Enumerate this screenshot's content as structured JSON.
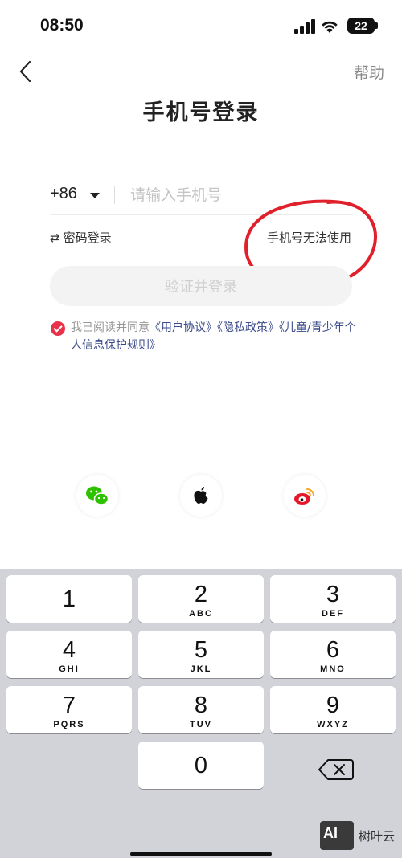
{
  "status_bar": {
    "time": "08:50",
    "battery": "22"
  },
  "nav": {
    "help_label": "帮助"
  },
  "title": "手机号登录",
  "phone": {
    "country_code": "+86",
    "placeholder": "请输入手机号",
    "value": ""
  },
  "links": {
    "password_login": "密码登录",
    "phone_unavailable": "手机号无法使用"
  },
  "verify_button": "验证并登录",
  "agreement": {
    "prefix": "我已阅读并同意",
    "user_agreement": "《用户协议》",
    "privacy_policy": "《隐私政策》",
    "children_rules": "《儿童/青少年个人信息保护规则》",
    "checked": true
  },
  "social": [
    "wechat-icon",
    "apple-icon",
    "weibo-icon"
  ],
  "keyboard": {
    "keys": [
      {
        "digit": "1",
        "letters": ""
      },
      {
        "digit": "2",
        "letters": "ABC"
      },
      {
        "digit": "3",
        "letters": "DEF"
      },
      {
        "digit": "4",
        "letters": "GHI"
      },
      {
        "digit": "5",
        "letters": "JKL"
      },
      {
        "digit": "6",
        "letters": "MNO"
      },
      {
        "digit": "7",
        "letters": "PQRS"
      },
      {
        "digit": "8",
        "letters": "TUV"
      },
      {
        "digit": "9",
        "letters": "WXYZ"
      },
      {
        "digit": "0",
        "letters": ""
      }
    ]
  },
  "watermark": {
    "logo": "AI",
    "text": "树叶云"
  },
  "colors": {
    "accent_red": "#e8324a",
    "annotation_red": "#e0202a",
    "link_blue": "#3a4a8a",
    "wechat_green": "#2dc100",
    "weibo_red": "#e6162d"
  }
}
